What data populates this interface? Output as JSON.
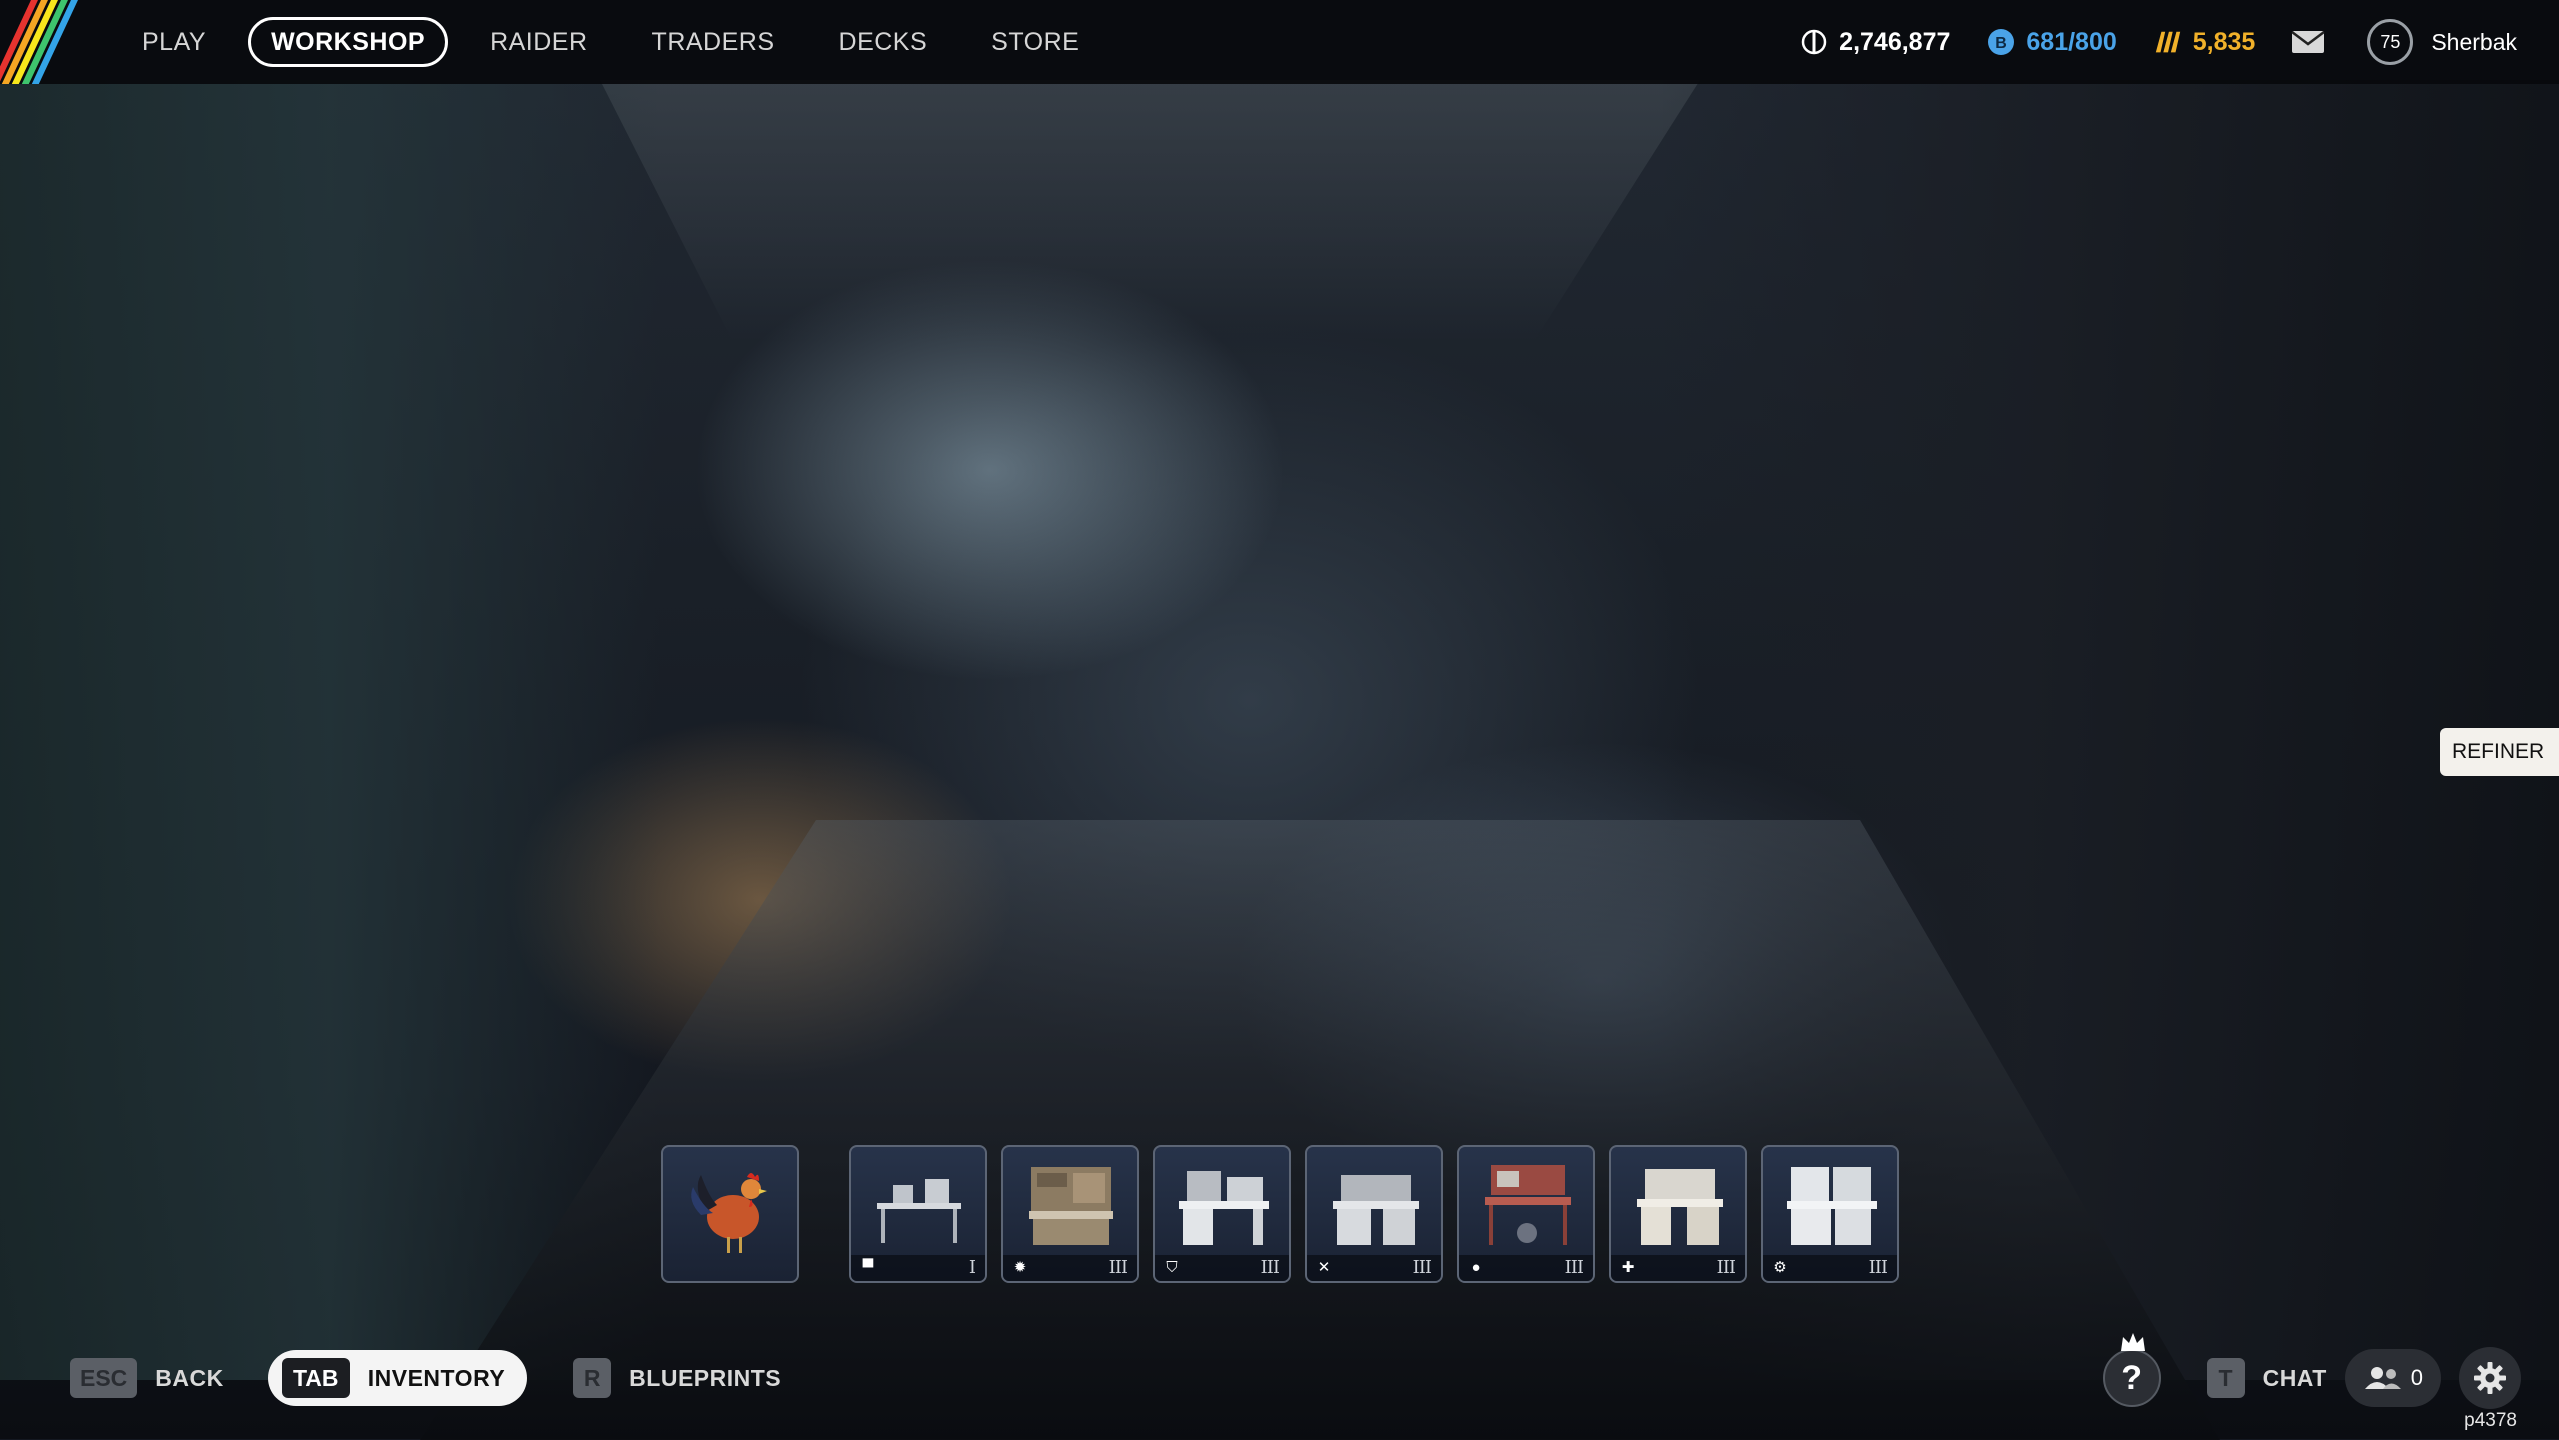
{
  "nav": {
    "items": [
      {
        "label": "PLAY",
        "active": false
      },
      {
        "label": "WORKSHOP",
        "active": true
      },
      {
        "label": "RAIDER",
        "active": false
      },
      {
        "label": "TRADERS",
        "active": false
      },
      {
        "label": "DECKS",
        "active": false
      },
      {
        "label": "STORE",
        "active": false
      }
    ]
  },
  "currencies": {
    "coins": {
      "value": "2,746,877",
      "icon": "coin-icon",
      "color": "#ffffff"
    },
    "tokens": {
      "value": "681/800",
      "icon": "token-icon",
      "color": "#4aa3e8"
    },
    "premium": {
      "value": "5,835",
      "icon": "premium-currency-icon",
      "color": "#f1b12a"
    }
  },
  "profile": {
    "level": "75",
    "username": "Sherbak"
  },
  "scene_label": {
    "text": "REFINER"
  },
  "benches": [
    {
      "name": "rooster",
      "tier": ""
    },
    {
      "name": "bench-1",
      "icon": "bench-icon",
      "tier": "I"
    },
    {
      "name": "bench-2",
      "icon": "explosive-icon",
      "tier": "III"
    },
    {
      "name": "bench-3",
      "icon": "shield-icon",
      "tier": "III"
    },
    {
      "name": "bench-4",
      "icon": "tools-icon",
      "tier": "III"
    },
    {
      "name": "bench-5",
      "icon": "utility-icon",
      "tier": "III"
    },
    {
      "name": "bench-6",
      "icon": "medical-icon",
      "tier": "III"
    },
    {
      "name": "bench-7",
      "icon": "refiner-icon",
      "tier": "III"
    }
  ],
  "bottom": {
    "back": {
      "key": "ESC",
      "label": "BACK"
    },
    "inventory": {
      "key": "TAB",
      "label": "INVENTORY"
    },
    "blueprints": {
      "key": "R",
      "label": "BLUEPRINTS"
    },
    "chat": {
      "key": "T",
      "label": "CHAT"
    },
    "friends_count": "0",
    "build": "p4378"
  },
  "colors": {
    "accent_blue": "#4aa3e8",
    "accent_gold": "#f1b12a",
    "logo_stripes": [
      "#e7332f",
      "#f5a623",
      "#f8e71c",
      "#3ec46d",
      "#33a4e8"
    ]
  }
}
